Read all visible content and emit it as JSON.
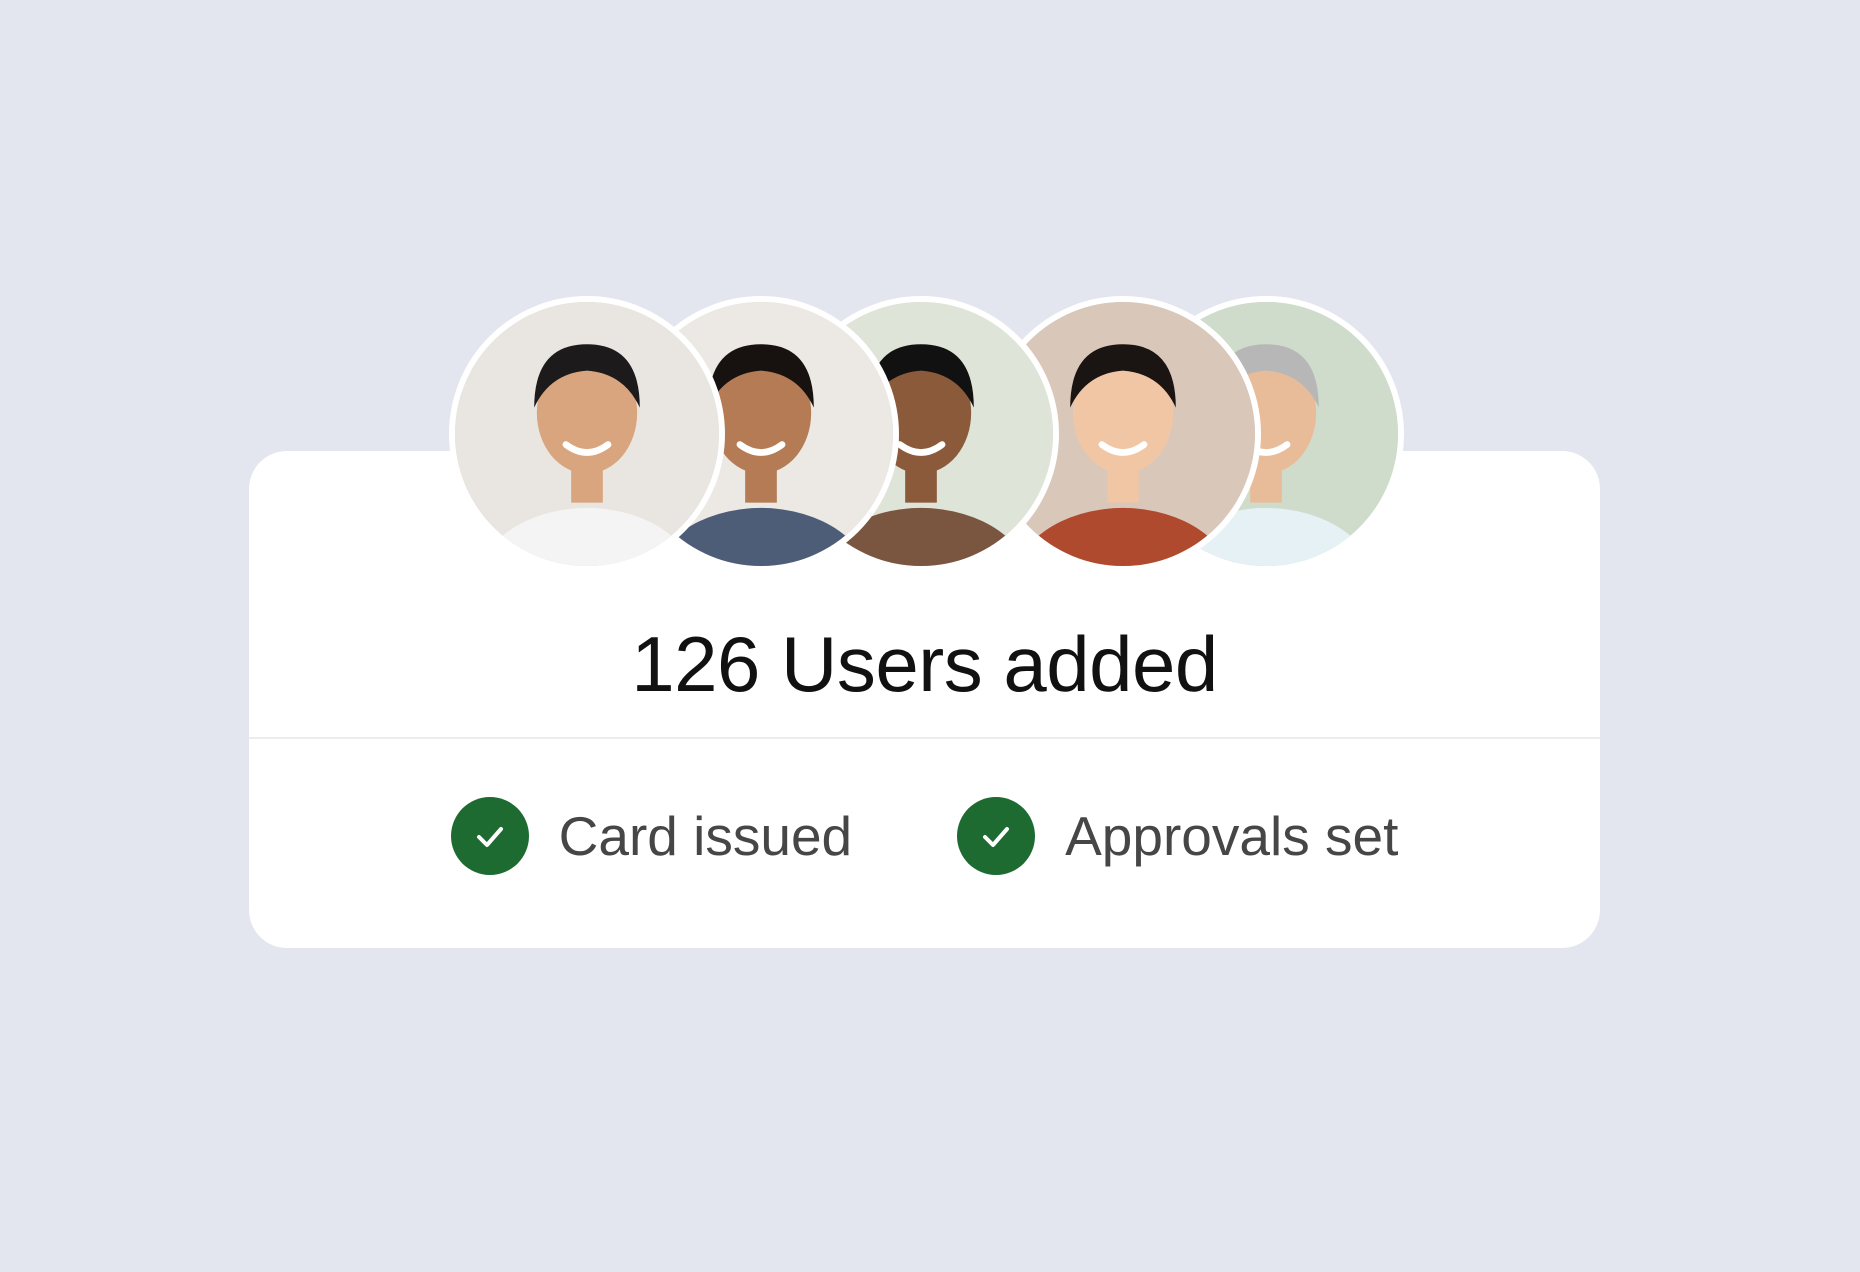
{
  "summary": {
    "title": "126 Users added"
  },
  "avatars": [
    {
      "name": "user-avatar-1",
      "skin": "#d9a57f",
      "hair": "#1c1a1a",
      "shirt": "#f4f4f4",
      "bg": "#e9e6e1"
    },
    {
      "name": "user-avatar-2",
      "skin": "#b47b55",
      "hair": "#17120f",
      "shirt": "#4d5d78",
      "bg": "#ece8e4"
    },
    {
      "name": "user-avatar-3",
      "skin": "#8a5a3b",
      "hair": "#111111",
      "shirt": "#7a5540",
      "bg": "#dfe4d8"
    },
    {
      "name": "user-avatar-4",
      "skin": "#f0c6a4",
      "hair": "#1a1412",
      "shirt": "#b04a2e",
      "bg": "#d9c7ba"
    },
    {
      "name": "user-avatar-5",
      "skin": "#e8bc99",
      "hair": "#b7b7b7",
      "shirt": "#e6f1f6",
      "bg": "#cfdccb"
    }
  ],
  "statuses": [
    {
      "label": "Card issued",
      "icon": "check-circle-icon",
      "color": "#1d6b30"
    },
    {
      "label": "Approvals set",
      "icon": "check-circle-icon",
      "color": "#1d6b30"
    }
  ]
}
